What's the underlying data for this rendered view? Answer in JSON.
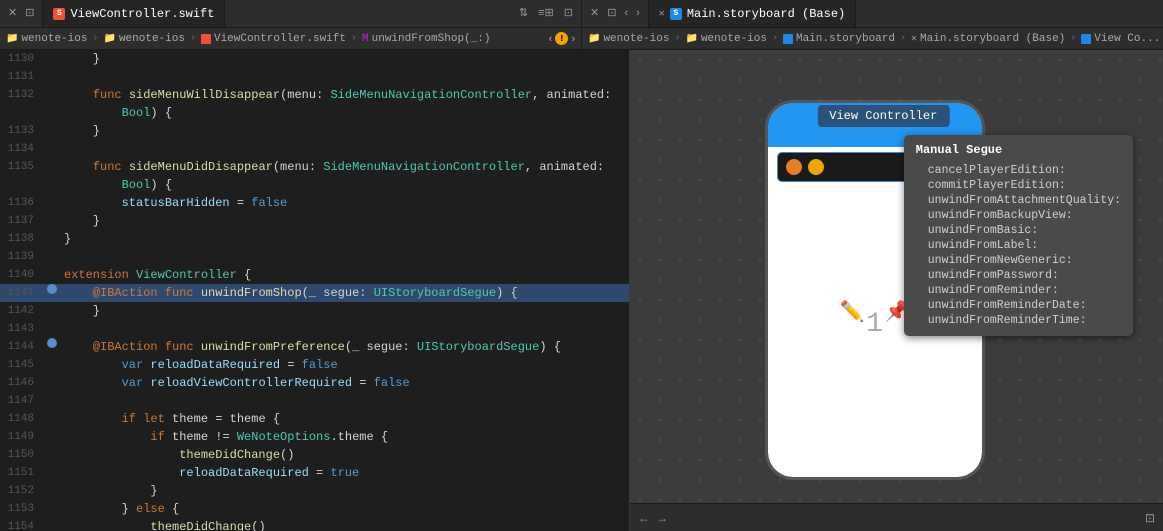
{
  "tabs": {
    "left": {
      "controls": [
        "←",
        "→"
      ],
      "active_tab": {
        "label": "ViewController.swift",
        "icon": "swift"
      },
      "extra_buttons": [
        "⇅",
        "≡⊞",
        "⊡"
      ]
    },
    "right": {
      "close_btn": "×",
      "active_tab": {
        "label": "Main.storyboard (Base)",
        "icon": "storyboard"
      },
      "controls": [
        "←",
        "→"
      ]
    }
  },
  "breadcrumb": {
    "left": {
      "items": [
        "wenote-ios",
        "wenote-ios",
        "ViewController.swift",
        "M",
        "unwindFromShop(_:)"
      ],
      "icons": [
        "folder",
        "folder",
        "swift",
        "m-icon",
        null
      ],
      "warning": "!"
    },
    "right": {
      "items": [
        "wenote-ios",
        "wenote-ios",
        "Main.storyboard",
        "Main.storyboard (Base)",
        "View Co..."
      ],
      "icons": [
        "folder",
        "folder",
        "storyboard",
        "close",
        "storyboard"
      ]
    }
  },
  "code": {
    "lines": [
      {
        "num": "1130",
        "content": "    }",
        "gutter": ""
      },
      {
        "num": "1131",
        "content": "",
        "gutter": ""
      },
      {
        "num": "1132",
        "content": "    func sideMenuWillDisappear(menu: SideMenuNavigationController, animated:",
        "gutter": ""
      },
      {
        "num": "1133",
        "content": "            Bool) {",
        "gutter": ""
      },
      {
        "num": "",
        "content": "    }",
        "gutter": ""
      },
      {
        "num": "1134",
        "content": "",
        "gutter": ""
      },
      {
        "num": "1135",
        "content": "    func sideMenuDidDisappear(menu: SideMenuNavigationController, animated:",
        "gutter": ""
      },
      {
        "num": "1136",
        "content": "            Bool) {",
        "gutter": ""
      },
      {
        "num": "1137",
        "content": "        statusBarHidden = false",
        "gutter": ""
      },
      {
        "num": "1138",
        "content": "    }",
        "gutter": ""
      },
      {
        "num": "1139",
        "content": "}",
        "gutter": ""
      },
      {
        "num": "1140",
        "content": "",
        "gutter": ""
      },
      {
        "num": "1141",
        "content": "extension ViewController {",
        "gutter": ""
      },
      {
        "num": "1141",
        "content": "    @IBAction func unwindFromShop(_ segue: UIStoryboardSegue) {",
        "gutter": "bp",
        "highlighted": true
      },
      {
        "num": "1142",
        "content": "    }",
        "gutter": ""
      },
      {
        "num": "1143",
        "content": "",
        "gutter": ""
      },
      {
        "num": "1144",
        "content": "    @IBAction func unwindFromPreference(_ segue: UIStoryboardSegue) {",
        "gutter": "bp"
      },
      {
        "num": "1145",
        "content": "        var reloadDataRequired = false",
        "gutter": ""
      },
      {
        "num": "1146",
        "content": "        var reloadViewControllerRequired = false",
        "gutter": ""
      },
      {
        "num": "1147",
        "content": "",
        "gutter": ""
      },
      {
        "num": "1148",
        "content": "        if let theme = theme {",
        "gutter": ""
      },
      {
        "num": "1149",
        "content": "            if theme != WeNoteOptions.theme {",
        "gutter": ""
      },
      {
        "num": "1150",
        "content": "                themeDidChange()",
        "gutter": ""
      },
      {
        "num": "1151",
        "content": "                reloadDataRequired = true",
        "gutter": ""
      },
      {
        "num": "1152",
        "content": "            }",
        "gutter": ""
      },
      {
        "num": "1153",
        "content": "        } else {",
        "gutter": ""
      },
      {
        "num": "1154",
        "content": "            themeDidChange()",
        "gutter": ""
      }
    ]
  },
  "storyboard": {
    "vc_label": "View Controller",
    "tooltip": {
      "title": "Manual Segue",
      "items": [
        "cancelPlayerEdition:",
        "commitPlayerEdition:",
        "unwindFromAttachmentQuality:",
        "unwindFromBackupView:",
        "unwindFromBasic:",
        "unwindFromLabel:",
        "unwindFromNewGeneric:",
        "unwindFromPassword:",
        "unwindFromReminder:",
        "unwindFromReminderDate:",
        "unwindFromReminderTime:"
      ],
      "selected": "unwindFromShop(_:"
    }
  }
}
